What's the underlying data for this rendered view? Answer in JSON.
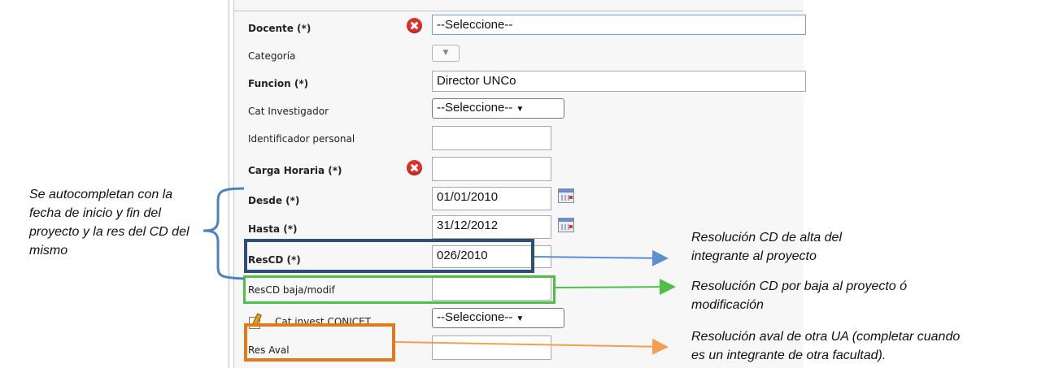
{
  "form": {
    "docente": {
      "label": "Docente (*)",
      "value": "--Seleccione--"
    },
    "categoria": {
      "label": "Categoría",
      "arrow": "▼"
    },
    "funcion": {
      "label": "Funcion (*)",
      "value": "Director UNCo"
    },
    "cat_investigador": {
      "label": "Cat Investigador",
      "value": "--Seleccione--",
      "arrow": "▼"
    },
    "identificador": {
      "label": "Identificador personal",
      "value": ""
    },
    "carga_horaria": {
      "label": "Carga Horaria (*)",
      "value": ""
    },
    "desde": {
      "label": "Desde (*)",
      "value": "01/01/2010"
    },
    "hasta": {
      "label": "Hasta (*)",
      "value": "31/12/2012"
    },
    "rescd": {
      "label": "ResCD (*)",
      "value": "026/2010"
    },
    "rescd_baja": {
      "label": "ResCD baja/modif",
      "value": ""
    },
    "cat_conicet": {
      "label": "Cat invest CONICET",
      "value": "--Seleccione--",
      "arrow": "▼"
    },
    "res_aval": {
      "label": "Res Aval",
      "value": ""
    }
  },
  "annotations": {
    "left_note": [
      "Se autocompletan con la",
      "fecha de inicio y fin del",
      "proyecto y la res del CD del",
      "mismo"
    ],
    "rescd_note": [
      "Resolución CD de alta del",
      "integrante al proyecto"
    ],
    "baja_note": [
      "Resolución CD por baja al proyecto ó",
      "modificación"
    ],
    "aval_note": [
      "Resolución aval de otra UA (completar cuando",
      "es un integrante de otra facultad)."
    ]
  },
  "colors": {
    "navy_box": "#2e4f75",
    "green_box": "#4fbf4a",
    "orange_box": "#e27a1b",
    "blue_brace": "#4f81bd",
    "blue_arrow": "#5b8fd0",
    "green_arrow": "#4fbf4a",
    "orange_arrow": "#f0a050",
    "error_icon": "#e0302c"
  },
  "icons": [
    "error-icon",
    "calendar-icon",
    "note-edit-icon",
    "dropdown-arrow-icon"
  ]
}
